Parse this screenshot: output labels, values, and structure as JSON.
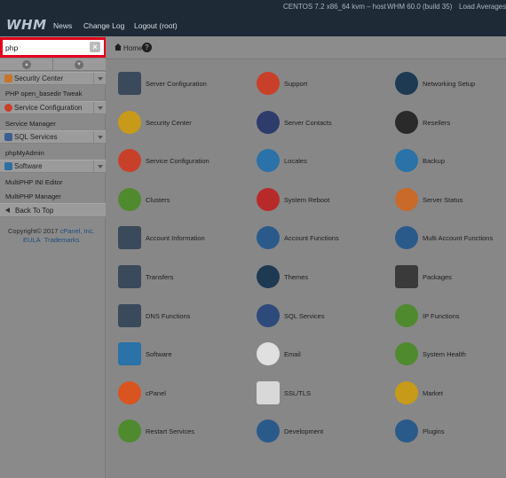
{
  "header": {
    "logo_text": "WHM",
    "nav": [
      "News",
      "Change Log",
      "Logout (root)"
    ],
    "os": "CENTOS 7.2 x86_64 kvm – host",
    "version": "WHM 60.0 (build 35)",
    "load_label": "Load Averages:"
  },
  "sidebar": {
    "search_value": "php",
    "clear_label": "×",
    "categories": [
      {
        "label": "Security Center",
        "color": "#c8742a",
        "items": [
          "PHP open_basedir Tweak"
        ]
      },
      {
        "label": "Service Configuration",
        "color": "#c8402a",
        "items": [
          "Service Manager"
        ]
      },
      {
        "label": "SQL Services",
        "color": "#3a5e90",
        "items": [
          "phpMyAdmin"
        ]
      },
      {
        "label": "Software",
        "color": "#2f6fa0",
        "items": [
          "MultiPHP INI Editor",
          "MultiPHP Manager"
        ]
      }
    ],
    "back_to_top": "Back To Top",
    "copyright_line1": "Copyright© 2017 ",
    "copyright_company": "cPanel, Inc.",
    "eula": "EULA",
    "trademarks": "Trademarks"
  },
  "content": {
    "breadcrumb_home": "Home",
    "help_symbol": "?",
    "grid": [
      [
        {
          "label": "Server Configuration",
          "icon": "server-config-icon",
          "color": "#3a4a5a"
        },
        {
          "label": "Support",
          "icon": "lifebuoy-icon",
          "color": "#c8402a"
        },
        {
          "label": "Networking Setup",
          "icon": "network-globe-icon",
          "color": "#1e3a52"
        }
      ],
      [
        {
          "label": "Security Center",
          "icon": "padlock-icon",
          "color": "#c89a1a"
        },
        {
          "label": "Server Contacts",
          "icon": "contacts-icon",
          "color": "#2d3c6a"
        },
        {
          "label": "Resellers",
          "icon": "resellers-icon",
          "color": "#2a2a2a"
        }
      ],
      [
        {
          "label": "Service Configuration",
          "icon": "wrench-icon",
          "color": "#c8402a"
        },
        {
          "label": "Locales",
          "icon": "locales-icon",
          "color": "#2a72a8"
        },
        {
          "label": "Backup",
          "icon": "backup-clock-icon",
          "color": "#2a72a8"
        }
      ],
      [
        {
          "label": "Clusters",
          "icon": "clusters-icon",
          "color": "#4f8a2e"
        },
        {
          "label": "System Reboot",
          "icon": "power-icon",
          "color": "#b82a2a"
        },
        {
          "label": "Server Status",
          "icon": "gauge-icon",
          "color": "#c86a2a"
        }
      ],
      [
        {
          "label": "Account Information",
          "icon": "account-card-icon",
          "color": "#3a4a5a"
        },
        {
          "label": "Account Functions",
          "icon": "account-gear-icon",
          "color": "#2a5a8a"
        },
        {
          "label": "Multi Account Functions",
          "icon": "multi-account-icon",
          "color": "#2a5a8a"
        }
      ],
      [
        {
          "label": "Transfers",
          "icon": "transfer-server-icon",
          "color": "#3a4a5a"
        },
        {
          "label": "Themes",
          "icon": "themes-icon",
          "color": "#1e3a52"
        },
        {
          "label": "Packages",
          "icon": "package-box-icon",
          "color": "#3a3a3a"
        }
      ],
      [
        {
          "label": "DNS Functions",
          "icon": "dns-server-icon",
          "color": "#3a4a5a"
        },
        {
          "label": "SQL Services",
          "icon": "database-icon",
          "color": "#2d4a7a"
        },
        {
          "label": "IP Functions",
          "icon": "ip-icon",
          "color": "#4f8a2e"
        }
      ],
      [
        {
          "label": "Software",
          "icon": "software-window-icon",
          "color": "#2a72a8"
        },
        {
          "label": "Email",
          "icon": "email-at-icon",
          "color": "#e0e0e0"
        },
        {
          "label": "System Health",
          "icon": "health-pulse-icon",
          "color": "#4f8a2e"
        }
      ],
      [
        {
          "label": "cPanel",
          "icon": "cpanel-logo-icon",
          "color": "#d9541e"
        },
        {
          "label": "SSL/TLS",
          "icon": "certificate-icon",
          "color": "#d8d8d8"
        },
        {
          "label": "Market",
          "icon": "cart-icon",
          "color": "#c89a1a"
        }
      ],
      [
        {
          "label": "Restart Services",
          "icon": "restart-icon",
          "color": "#4f8a2e"
        },
        {
          "label": "Development",
          "icon": "development-tools-icon",
          "color": "#2a5a8a"
        },
        {
          "label": "Plugins",
          "icon": "plug-icon",
          "color": "#2a5a8a"
        }
      ]
    ]
  }
}
